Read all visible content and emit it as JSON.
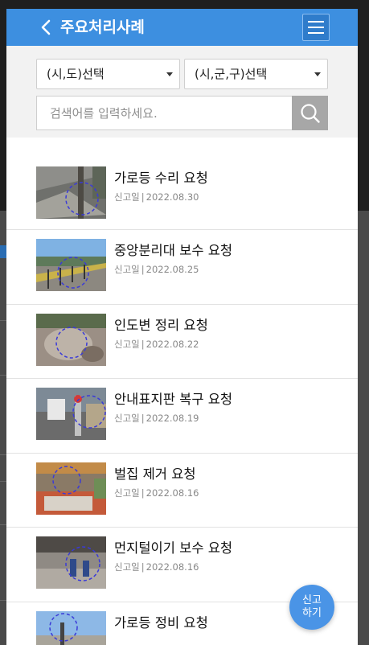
{
  "header": {
    "title": "주요처리사례",
    "back_icon": "chevron-left-icon",
    "menu_icon": "hamburger-menu-icon"
  },
  "filters": {
    "sido": {
      "value": "(시,도)선택"
    },
    "sigungu": {
      "value": "(시,군,구)선택"
    },
    "search": {
      "placeholder": "검색어를 입력하세요.",
      "icon": "search-icon"
    }
  },
  "items": [
    {
      "title": "가로등 수리 요청",
      "meta_label": "신고일",
      "date": "2022.08.30"
    },
    {
      "title": "중앙분리대 보수 요청",
      "meta_label": "신고일",
      "date": "2022.08.25"
    },
    {
      "title": "인도변 정리 요청",
      "meta_label": "신고일",
      "date": "2022.08.22"
    },
    {
      "title": "안내표지판 복구 요청",
      "meta_label": "신고일",
      "date": "2022.08.19"
    },
    {
      "title": "벌집 제거 요청",
      "meta_label": "신고일",
      "date": "2022.08.16"
    },
    {
      "title": "먼지털이기 보수 요청",
      "meta_label": "신고일",
      "date": "2022.08.16"
    },
    {
      "title": "가로등 정비 요청",
      "meta_label": "신고일",
      "date": ""
    }
  ],
  "fab": {
    "label": "신고하기"
  },
  "colors": {
    "header": "#3d8fe0",
    "fab": "#4a94e6",
    "search_button": "#a7a7a7"
  }
}
